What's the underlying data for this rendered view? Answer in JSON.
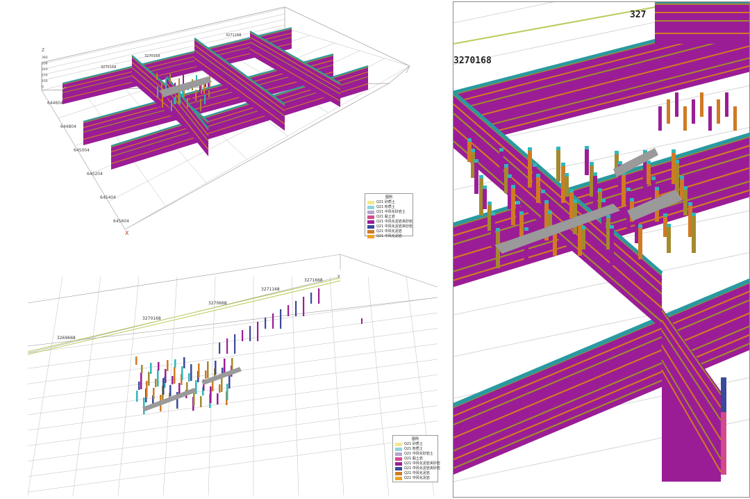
{
  "colors": {
    "magenta": "#9b1d96",
    "olive": "#a38a2e",
    "orange": "#d07a24",
    "cyan": "#2fb7b9",
    "teal": "#2a9aa0",
    "green": "#b6cc5a",
    "grey": "#9a9a9a",
    "pink": "#d24a8c",
    "navy": "#3a4a9a",
    "frame": "#888888",
    "axis_label": "#444444"
  },
  "top_view": {
    "z_axis": {
      "title": "Z",
      "ticks": [
        "360",
        "330",
        "310",
        "270",
        "150",
        "0"
      ]
    },
    "y_ticks": [
      "644604",
      "644804",
      "645004",
      "645204",
      "645404",
      "645604"
    ],
    "top_x_label_left": "3270168",
    "top_x_label_mid_left": "3270168",
    "top_x_label_right": "3271168",
    "axis_letter": "X"
  },
  "bottom_view": {
    "x_ticks": [
      "3269668",
      "3270168",
      "3270668",
      "3271168",
      "3271668"
    ],
    "axis_letter": "Y"
  },
  "right_view": {
    "label_left": "3270168",
    "label_top": "327"
  },
  "legend": {
    "title": "图例",
    "items": [
      {
        "label": "Q21 砂质土",
        "color": "#f4e88a"
      },
      {
        "label": "Q21 粉质土",
        "color": "#8fd3de"
      },
      {
        "label": "Q21 中风化砂岩土",
        "color": "#b3a5d0"
      },
      {
        "label": "Q21 黏土岩",
        "color": "#d24a8c"
      },
      {
        "label": "Q21 中风化泥岩夹砂岩",
        "color": "#9b1d96"
      },
      {
        "label": "Q21 中风化泥岩夹砂岩",
        "color": "#3a4a9a"
      },
      {
        "label": "Q21 中风化泥岩",
        "color": "#d07a24"
      },
      {
        "label": "Q21 中风化泥岩",
        "color": "#f0a020"
      }
    ]
  }
}
